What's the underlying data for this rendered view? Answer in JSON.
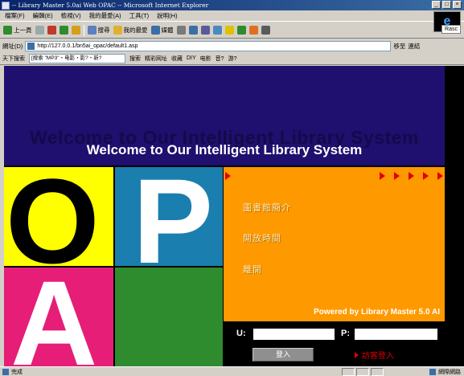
{
  "window": {
    "title": "-- Library Master 5.0ai Web OPAC -- Microsoft Internet Explorer",
    "buttons": [
      "_",
      "□",
      "×"
    ]
  },
  "menubar": {
    "items": [
      "檔案(F)",
      "編輯(E)",
      "檢視(V)",
      "我的最愛(A)",
      "工具(T)",
      "說明(H)"
    ]
  },
  "toolbar": {
    "back": "上一頁",
    "search": "搜尋",
    "favorites": "我的最愛",
    "media": "媒體",
    "right_label": "Rasc"
  },
  "address": {
    "label": "網址(D)",
    "url": "http://127.0.0.1/bn5ai_opac/default1.asp",
    "go": "移至",
    "links": "連結"
  },
  "linksbar": {
    "search_label": "天下搜索",
    "search_value": "[搜索 \"MP3\"・电影・影?・新?",
    "items": [
      "搜索",
      "精彩网址",
      "收藏",
      "DIY",
      "电影",
      "音?",
      "游?"
    ]
  },
  "page": {
    "banner_shadow": "Welcome to Our Intelligent Library System",
    "banner_title": "Welcome to Our Intelligent Library System",
    "tiles": {
      "o": "O",
      "p": "P",
      "a": "A"
    },
    "menu": [
      "圖書館簡介",
      "開放時間",
      "離開"
    ],
    "powered_by": "Powered by Library Master 5.0 AI",
    "login": {
      "user_label": "U:",
      "pass_label": "P:",
      "submit": "登入",
      "guest": "訪客登入"
    },
    "colors": {
      "banner": "#1f0f6e",
      "yellow": "#ffff00",
      "blue": "#1a7fae",
      "magenta": "#e61e78",
      "green": "#2e8b2e",
      "orange": "#ff9900",
      "accent_red": "#e00000"
    }
  },
  "status": {
    "text": "完成",
    "zone": "網際網路"
  }
}
